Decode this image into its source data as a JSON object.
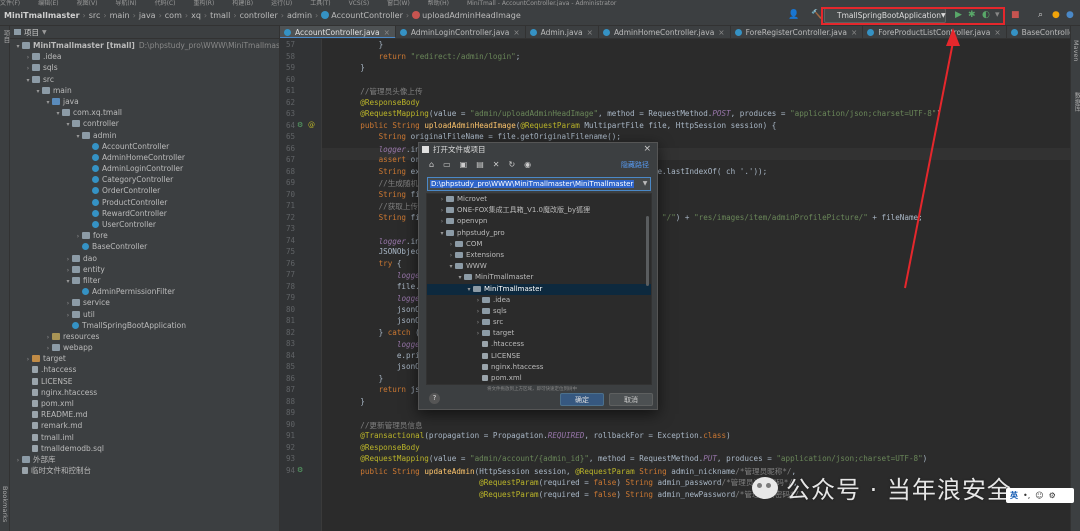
{
  "menubar": {
    "items": [
      "文件(F)",
      "编辑(E)",
      "视图(V)",
      "导航(N)",
      "代码(C)",
      "重构(R)",
      "构建(B)",
      "运行(U)",
      "工具(T)",
      "VCS(S)",
      "窗口(W)",
      "帮助(H)",
      "MiniTmall - AccountController.java - Administrator"
    ]
  },
  "breadcrumb": {
    "items": [
      "MiniTmallmaster",
      "src",
      "main",
      "java",
      "com",
      "xq",
      "tmall",
      "controller",
      "admin",
      "AccountController",
      "uploadAdminHeadImage"
    ]
  },
  "run_config": {
    "name": "TmallSpringBootApplication"
  },
  "left_strip": {
    "top": "项目",
    "bottom": "Bookmarks"
  },
  "right_strip": {
    "top": "Maven",
    "second": "数据库"
  },
  "project_panel": {
    "title": "项目",
    "rows": [
      {
        "indent": 0,
        "arrow": "▾",
        "icon": "folder",
        "label": "MiniTmallmaster [tmall]",
        "path": "D:\\phpstudy_pro\\WWW\\MiniTmallmaster\\MiniTm",
        "bold": true
      },
      {
        "indent": 1,
        "arrow": "›",
        "icon": "folder",
        "label": ".idea"
      },
      {
        "indent": 1,
        "arrow": "›",
        "icon": "folder",
        "label": "sqls"
      },
      {
        "indent": 1,
        "arrow": "▾",
        "icon": "folder",
        "label": "src"
      },
      {
        "indent": 2,
        "arrow": "▾",
        "icon": "folder",
        "label": "main"
      },
      {
        "indent": 3,
        "arrow": "▾",
        "icon": "folder-src",
        "label": "java"
      },
      {
        "indent": 4,
        "arrow": "▾",
        "icon": "folder",
        "label": "com.xq.tmall"
      },
      {
        "indent": 5,
        "arrow": "▾",
        "icon": "folder",
        "label": "controller"
      },
      {
        "indent": 6,
        "arrow": "▾",
        "icon": "folder",
        "label": "admin"
      },
      {
        "indent": 7,
        "arrow": "",
        "icon": "class",
        "label": "AccountController"
      },
      {
        "indent": 7,
        "arrow": "",
        "icon": "class",
        "label": "AdminHomeController"
      },
      {
        "indent": 7,
        "arrow": "",
        "icon": "class",
        "label": "AdminLoginController"
      },
      {
        "indent": 7,
        "arrow": "",
        "icon": "class",
        "label": "CategoryController"
      },
      {
        "indent": 7,
        "arrow": "",
        "icon": "class",
        "label": "OrderController"
      },
      {
        "indent": 7,
        "arrow": "",
        "icon": "class",
        "label": "ProductController"
      },
      {
        "indent": 7,
        "arrow": "",
        "icon": "class",
        "label": "RewardController"
      },
      {
        "indent": 7,
        "arrow": "",
        "icon": "class",
        "label": "UserController"
      },
      {
        "indent": 6,
        "arrow": "›",
        "icon": "folder",
        "label": "fore"
      },
      {
        "indent": 6,
        "arrow": "",
        "icon": "class",
        "label": "BaseController"
      },
      {
        "indent": 5,
        "arrow": "›",
        "icon": "folder",
        "label": "dao"
      },
      {
        "indent": 5,
        "arrow": "›",
        "icon": "folder",
        "label": "entity"
      },
      {
        "indent": 5,
        "arrow": "▾",
        "icon": "folder",
        "label": "filter"
      },
      {
        "indent": 6,
        "arrow": "",
        "icon": "class",
        "label": "AdminPermissionFilter"
      },
      {
        "indent": 5,
        "arrow": "›",
        "icon": "folder",
        "label": "service"
      },
      {
        "indent": 5,
        "arrow": "›",
        "icon": "folder",
        "label": "util"
      },
      {
        "indent": 5,
        "arrow": "",
        "icon": "class",
        "label": "TmallSpringBootApplication"
      },
      {
        "indent": 3,
        "arrow": "›",
        "icon": "folder-res",
        "label": "resources"
      },
      {
        "indent": 3,
        "arrow": "›",
        "icon": "folder",
        "label": "webapp"
      },
      {
        "indent": 1,
        "arrow": "›",
        "icon": "folder-orange",
        "label": "target"
      },
      {
        "indent": 1,
        "arrow": "",
        "icon": "file",
        "label": ".htaccess"
      },
      {
        "indent": 1,
        "arrow": "",
        "icon": "file",
        "label": "LICENSE"
      },
      {
        "indent": 1,
        "arrow": "",
        "icon": "file",
        "label": "nginx.htaccess"
      },
      {
        "indent": 1,
        "arrow": "",
        "icon": "file",
        "label": "pom.xml"
      },
      {
        "indent": 1,
        "arrow": "",
        "icon": "file",
        "label": "README.md"
      },
      {
        "indent": 1,
        "arrow": "",
        "icon": "file",
        "label": "remark.md"
      },
      {
        "indent": 1,
        "arrow": "",
        "icon": "file",
        "label": "tmall.iml"
      },
      {
        "indent": 1,
        "arrow": "",
        "icon": "file",
        "label": "tmalldemodb.sql"
      },
      {
        "indent": 0,
        "arrow": "›",
        "icon": "folder",
        "label": "外部库"
      },
      {
        "indent": 0,
        "arrow": "",
        "icon": "file",
        "label": "临时文件和控制台"
      }
    ]
  },
  "tabs": [
    {
      "label": "AccountController.java",
      "active": true
    },
    {
      "label": "AdminLoginController.java",
      "active": false
    },
    {
      "label": "Admin.java",
      "active": false
    },
    {
      "label": "AdminHomeController.java",
      "active": false
    },
    {
      "label": "ForeRegisterController.java",
      "active": false
    },
    {
      "label": "ForeProductListController.java",
      "active": false
    },
    {
      "label": "BaseController.java",
      "active": false
    }
  ],
  "editor": {
    "line_numbers": [
      "57",
      "58",
      "59",
      "60",
      "61",
      "62",
      "63",
      "64",
      "65",
      "66",
      "67",
      "68",
      "69",
      "70",
      "71",
      "72",
      "73",
      "74",
      "75",
      "76",
      "77",
      "78",
      "79",
      "80",
      "81",
      "82",
      "83",
      "84",
      "85",
      "86",
      "87",
      "88",
      "89",
      "90",
      "91",
      "92",
      "93",
      "94"
    ],
    "lines": [
      "        }",
      "        return \"redirect:/admin/login\";",
      "    }",
      "",
      "    //管理员头像上传",
      "    @ResponseBody",
      "    @RequestMapping(value = \"admin/uploadAdminHeadImage\", method = RequestMethod.POST, produces = \"application/json;charset=UTF-8\")",
      "    public String uploadAdminHeadImage(@RequestParam MultipartFile file, HttpSession session) {",
      "        String originalFileName = file.getOriginalFilename();",
      "        logger.info(\"获取图片原始文件名：{}\", originalFileName);",
      "        assert originalFileName != null;",
      "        String extension = originalFileName.substring(originalFileName.lastIndexOf( ch '.'));",
      "        //生成随机名",
      "        String fileName = UUID.randomUUID() + extension;",
      "        //获取上传路径",
      "        String filePath = session.getServletContext().getRealPath( s: \"/\") + \"res/images/item/adminProfilePicture/\" + fileName;",
      "",
      "        logger.info(\"文件上传路径：{}\", filePath);",
      "        JSONObject jsonObject = new JSONObject();",
      "        try {",
      "            logger.info(\"文件上传中...\");",
      "            file.transferTo(new File(filePath));",
      "            logger.info(\"文件上传成功！\");",
      "            jsonObject.put(\"success\", true);",
      "            jsonObject.put(\"fileName\", fileName);",
      "        } catch (IOException e) {",
      "            logger.warn(\"文件上传失败！\");",
      "            e.printStackTrace();",
      "            jsonObject.put(\"success\", false);",
      "        }",
      "        return jsonObject.toJSONString();",
      "    }",
      "",
      "    //更新管理员信息",
      "    @Transactional(propagation = Propagation.REQUIRED, rollbackFor = Exception.class)",
      "    @ResponseBody",
      "    @RequestMapping(value = \"admin/account/{admin_id}\", method = RequestMethod.PUT, produces = \"application/json;charset=UTF-8\")",
      "    public String updateAdmin(HttpSession session, @RequestParam String admin_nickname/*管理员昵称*/,",
      "                              @RequestParam(required = false) String admin_password/*管理员当前密码*/,",
      "                              @RequestParam(required = false) String admin_newPassword/*管理员新密码*/,"
    ]
  },
  "dialog": {
    "title": "打开文件或项目",
    "hide_path": "隐藏路径",
    "path_value": "D:\\phpstudy_pro\\WWW\\MiniTmallmaster\\MiniTmallmaster",
    "tree": [
      {
        "indent": 1,
        "arrow": "›",
        "label": "Microvet",
        "file": false,
        "sel": false
      },
      {
        "indent": 1,
        "arrow": "›",
        "label": "ONE-FOX集成工具箱_V1.0魔改版_by狐狸",
        "file": false,
        "sel": false
      },
      {
        "indent": 1,
        "arrow": "›",
        "label": "openvpn",
        "file": false,
        "sel": false
      },
      {
        "indent": 1,
        "arrow": "▾",
        "label": "phpstudy_pro",
        "file": false,
        "sel": false
      },
      {
        "indent": 2,
        "arrow": "›",
        "label": "COM",
        "file": false,
        "sel": false
      },
      {
        "indent": 2,
        "arrow": "›",
        "label": "Extensions",
        "file": false,
        "sel": false
      },
      {
        "indent": 2,
        "arrow": "▾",
        "label": "WWW",
        "file": false,
        "sel": false
      },
      {
        "indent": 3,
        "arrow": "▾",
        "label": "MiniTmallmaster",
        "file": false,
        "sel": false
      },
      {
        "indent": 4,
        "arrow": "▾",
        "label": "MiniTmallmaster",
        "file": false,
        "sel": true
      },
      {
        "indent": 5,
        "arrow": "›",
        "label": ".idea",
        "file": false,
        "sel": false
      },
      {
        "indent": 5,
        "arrow": "›",
        "label": "sqls",
        "file": false,
        "sel": false
      },
      {
        "indent": 5,
        "arrow": "›",
        "label": "src",
        "file": false,
        "sel": false
      },
      {
        "indent": 5,
        "arrow": "›",
        "label": "target",
        "file": false,
        "sel": false
      },
      {
        "indent": 5,
        "arrow": "",
        "label": ".htaccess",
        "file": true,
        "sel": false
      },
      {
        "indent": 5,
        "arrow": "",
        "label": "LICENSE",
        "file": true,
        "sel": false
      },
      {
        "indent": 5,
        "arrow": "",
        "label": "nginx.htaccess",
        "file": true,
        "sel": false
      },
      {
        "indent": 5,
        "arrow": "",
        "label": "pom.xml",
        "file": true,
        "sel": false
      }
    ],
    "hint": "将文件拖放到上方区域，即可快速定位到树中",
    "ok": "确定",
    "cancel": "取消",
    "help": "?"
  },
  "watermark": {
    "text": "公众号 · 当年浪安全"
  },
  "ime": {
    "lang": "英",
    "items": [
      "•,",
      "☺",
      "⚙"
    ]
  },
  "colors": {
    "accent": "#4a88c7",
    "highlight": "#e5272c",
    "run": "#59a869"
  }
}
